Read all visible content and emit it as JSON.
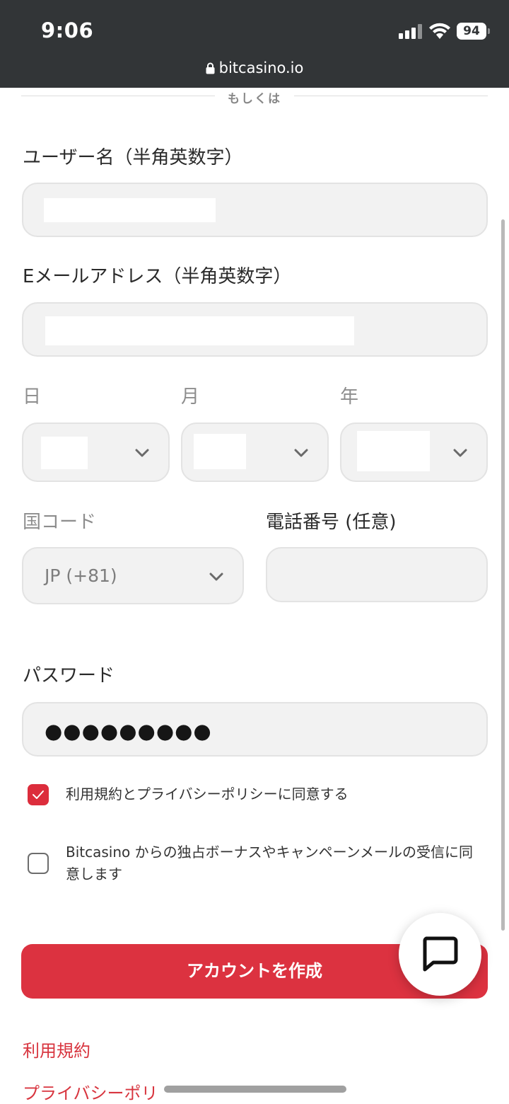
{
  "status_bar": {
    "time": "9:06",
    "battery": "94"
  },
  "browser": {
    "url": "bitcasino.io"
  },
  "divider": {
    "text": "もしくは"
  },
  "form": {
    "username_label": "ユーザー名（半角英数字）",
    "email_label": "Eメールアドレス（半角英数字）",
    "day_label": "日",
    "month_label": "月",
    "year_label": "年",
    "country_code_label": "国コード",
    "country_code_value": "JP (+81)",
    "phone_label": "電話番号 (任意)",
    "password_label": "パスワード",
    "password_mask": "●●●●●●●●●"
  },
  "checkboxes": {
    "terms": {
      "label": "利用規約とプライバシーポリシーに同意する",
      "checked": true
    },
    "marketing": {
      "label": "Bitcasino からの独占ボーナスやキャンペーンメールの受信に同意します",
      "checked": false
    }
  },
  "cta": {
    "label": "アカウントを作成"
  },
  "links": {
    "terms": "利用規約",
    "privacy": "プライバシーポリ"
  },
  "colors": {
    "accent": "#dc3240",
    "topbar": "#323537",
    "field_bg": "#f2f2f2"
  },
  "icons": {
    "chat": "chat-bubble-icon",
    "lock": "lock-icon",
    "chevron": "chevron-down-icon"
  }
}
